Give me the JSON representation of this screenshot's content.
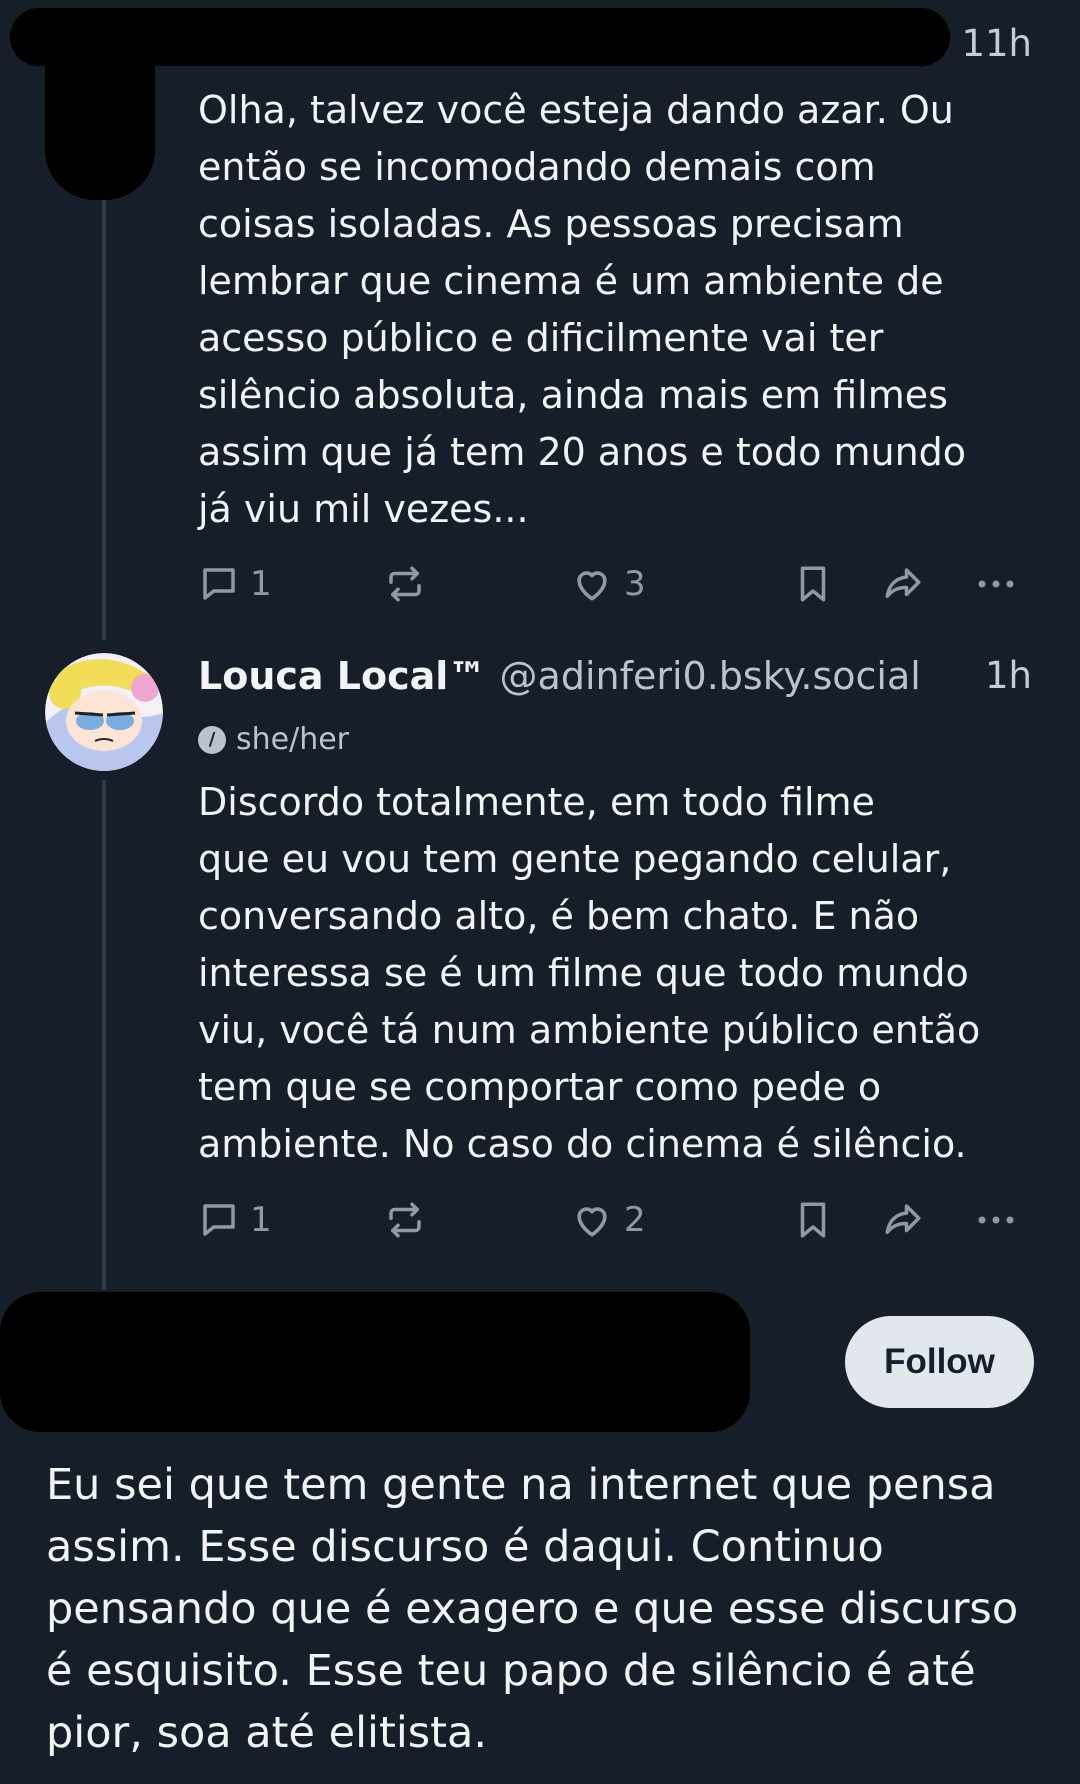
{
  "posts": [
    {
      "time": "11h",
      "text": "Olha, talvez você esteja dando azar. Ou\nentão se incomodando demais com\ncoisas isoladas. As pessoas precisam\nlembrar que cinema é um ambiente de\nacesso público e dificilmente vai ter\nsilêncio absoluta, ainda mais em filmes\nassim que já tem 20 anos e todo mundo\njá viu mil vezes...",
      "replies": "1",
      "likes": "3"
    },
    {
      "display_name": "Louca Local™",
      "handle": "@adinferi0.bsky.social",
      "time": "1h",
      "pronouns": "she/her",
      "text": "Discordo totalmente, em todo filme\nque eu vou tem gente pegando celular,\nconversando alto, é bem chato. E não\ninteressa se é um filme que todo mundo\nviu, você tá num ambiente público então\ntem que se comportar como pede o\nambiente. No caso do cinema é silêncio.",
      "replies": "1",
      "likes": "2"
    }
  ],
  "main_post": {
    "follow_label": "Follow",
    "text": "Eu sei que tem gente na internet que pensa\nassim. Esse discurso é daqui. Continuo\npensando que é exagero e que esse discurso\né esquisito. Esse teu papo de silêncio é até\npior, soa até elitista."
  },
  "colors": {
    "background": "#161e2a",
    "text": "#f1f3f5",
    "muted": "#8d99a8",
    "thread_line": "#2f3a49",
    "follow_button": "#e2e7ee"
  },
  "icons": [
    "reply-icon",
    "repost-icon",
    "like-icon",
    "bookmark-icon",
    "share-icon",
    "more-icon",
    "pronoun-icon"
  ]
}
